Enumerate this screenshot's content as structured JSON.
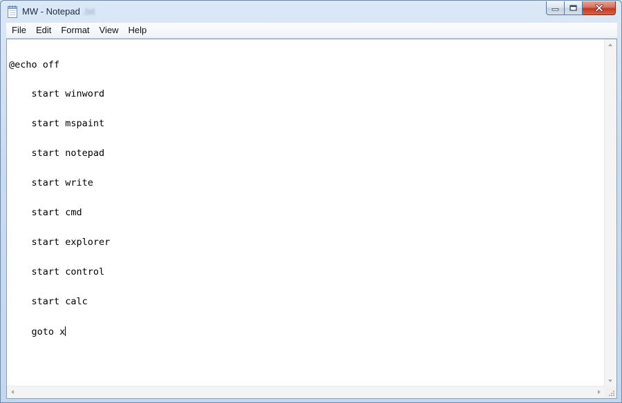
{
  "window": {
    "title": "MW - Notepad",
    "title_suffix": ".txt",
    "accent_close": "#c2391f"
  },
  "titlebar": {
    "icons": {
      "app": "notepad-icon",
      "minimize": "minimize-icon",
      "maximize": "maximize-icon",
      "close": "close-icon"
    }
  },
  "menu": {
    "items": [
      "File",
      "Edit",
      "Format",
      "View",
      "Help"
    ]
  },
  "editor": {
    "lines": [
      "@echo off",
      "    start winword",
      "    start mspaint",
      "    start notepad",
      "    start write",
      "    start cmd",
      "    start explorer",
      "    start control",
      "    start calc",
      "    goto x"
    ]
  }
}
